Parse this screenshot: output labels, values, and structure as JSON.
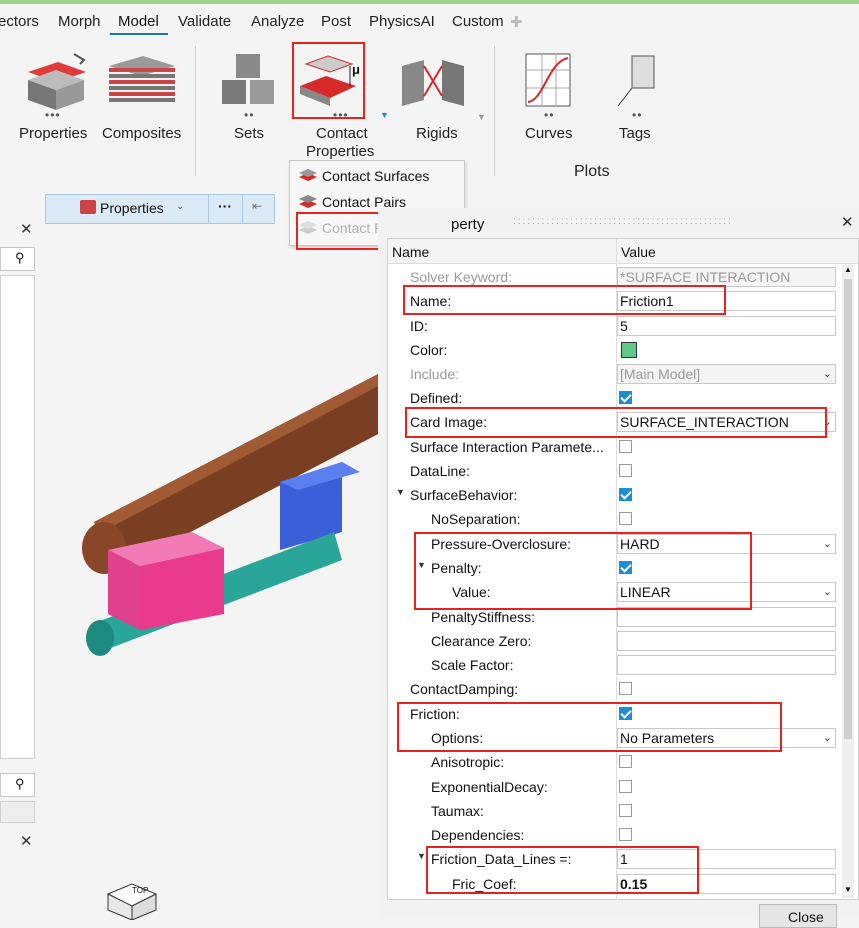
{
  "menu": {
    "tabs": [
      "ectors",
      "Morph",
      "Model",
      "Validate",
      "Analyze",
      "Post",
      "PhysicsAI",
      "Custom"
    ],
    "active": "Model"
  },
  "ribbon": {
    "properties_label": "Properties",
    "composites_label": "Composites",
    "sets_label": "Sets",
    "contact_label_1": "Contact",
    "contact_label_2": "Properties",
    "rigids_label": "Rigids",
    "curves_label": "Curves",
    "tags_label": "Tags",
    "plots_group": "Plots",
    "mu_symbol": "μ"
  },
  "dropdown": {
    "items": [
      "Contact Surfaces",
      "Contact Pairs",
      "Contact Properties"
    ]
  },
  "propbar": {
    "label": "Properties",
    "more": "···"
  },
  "panel": {
    "title_fragment": "perty",
    "col_name": "Name",
    "col_value": "Value",
    "close_button": "Close",
    "rows": [
      {
        "label": "Solver Keyword:",
        "value": "*SURFACE INTERACTION"
      },
      {
        "label": "Name:",
        "value": "Friction1"
      },
      {
        "label": "ID:",
        "value": "5"
      },
      {
        "label": "Color:",
        "value": ""
      },
      {
        "label": "Include:",
        "value": "[Main Model]"
      },
      {
        "label": "Defined:",
        "value": ""
      },
      {
        "label": "Card Image:",
        "value": "SURFACE_INTERACTION"
      },
      {
        "label": "Surface Interaction Paramete...",
        "value": ""
      },
      {
        "label": "DataLine:",
        "value": ""
      },
      {
        "label": "SurfaceBehavior:",
        "value": ""
      },
      {
        "label": "NoSeparation:",
        "value": ""
      },
      {
        "label": "Pressure-Overclosure:",
        "value": "HARD"
      },
      {
        "label": "Penalty:",
        "value": ""
      },
      {
        "label": "Value:",
        "value": "LINEAR"
      },
      {
        "label": "PenaltyStiffness:",
        "value": ""
      },
      {
        "label": "Clearance Zero:",
        "value": ""
      },
      {
        "label": "Scale Factor:",
        "value": ""
      },
      {
        "label": "ContactDamping:",
        "value": ""
      },
      {
        "label": "Friction:",
        "value": ""
      },
      {
        "label": "Options:",
        "value": "No Parameters"
      },
      {
        "label": "Anisotropic:",
        "value": ""
      },
      {
        "label": "ExponentialDecay:",
        "value": ""
      },
      {
        "label": "Taumax:",
        "value": ""
      },
      {
        "label": "Dependencies:",
        "value": ""
      },
      {
        "label": "Friction_Data_Lines =:",
        "value": "1"
      },
      {
        "label": "Fric_Coef:",
        "value": "0.15"
      }
    ]
  },
  "viewcube_label": "TOP",
  "colors": {
    "highlight": "#e8231c",
    "accent": "#1a8fd6",
    "color_swatch": "#5fc98a"
  }
}
